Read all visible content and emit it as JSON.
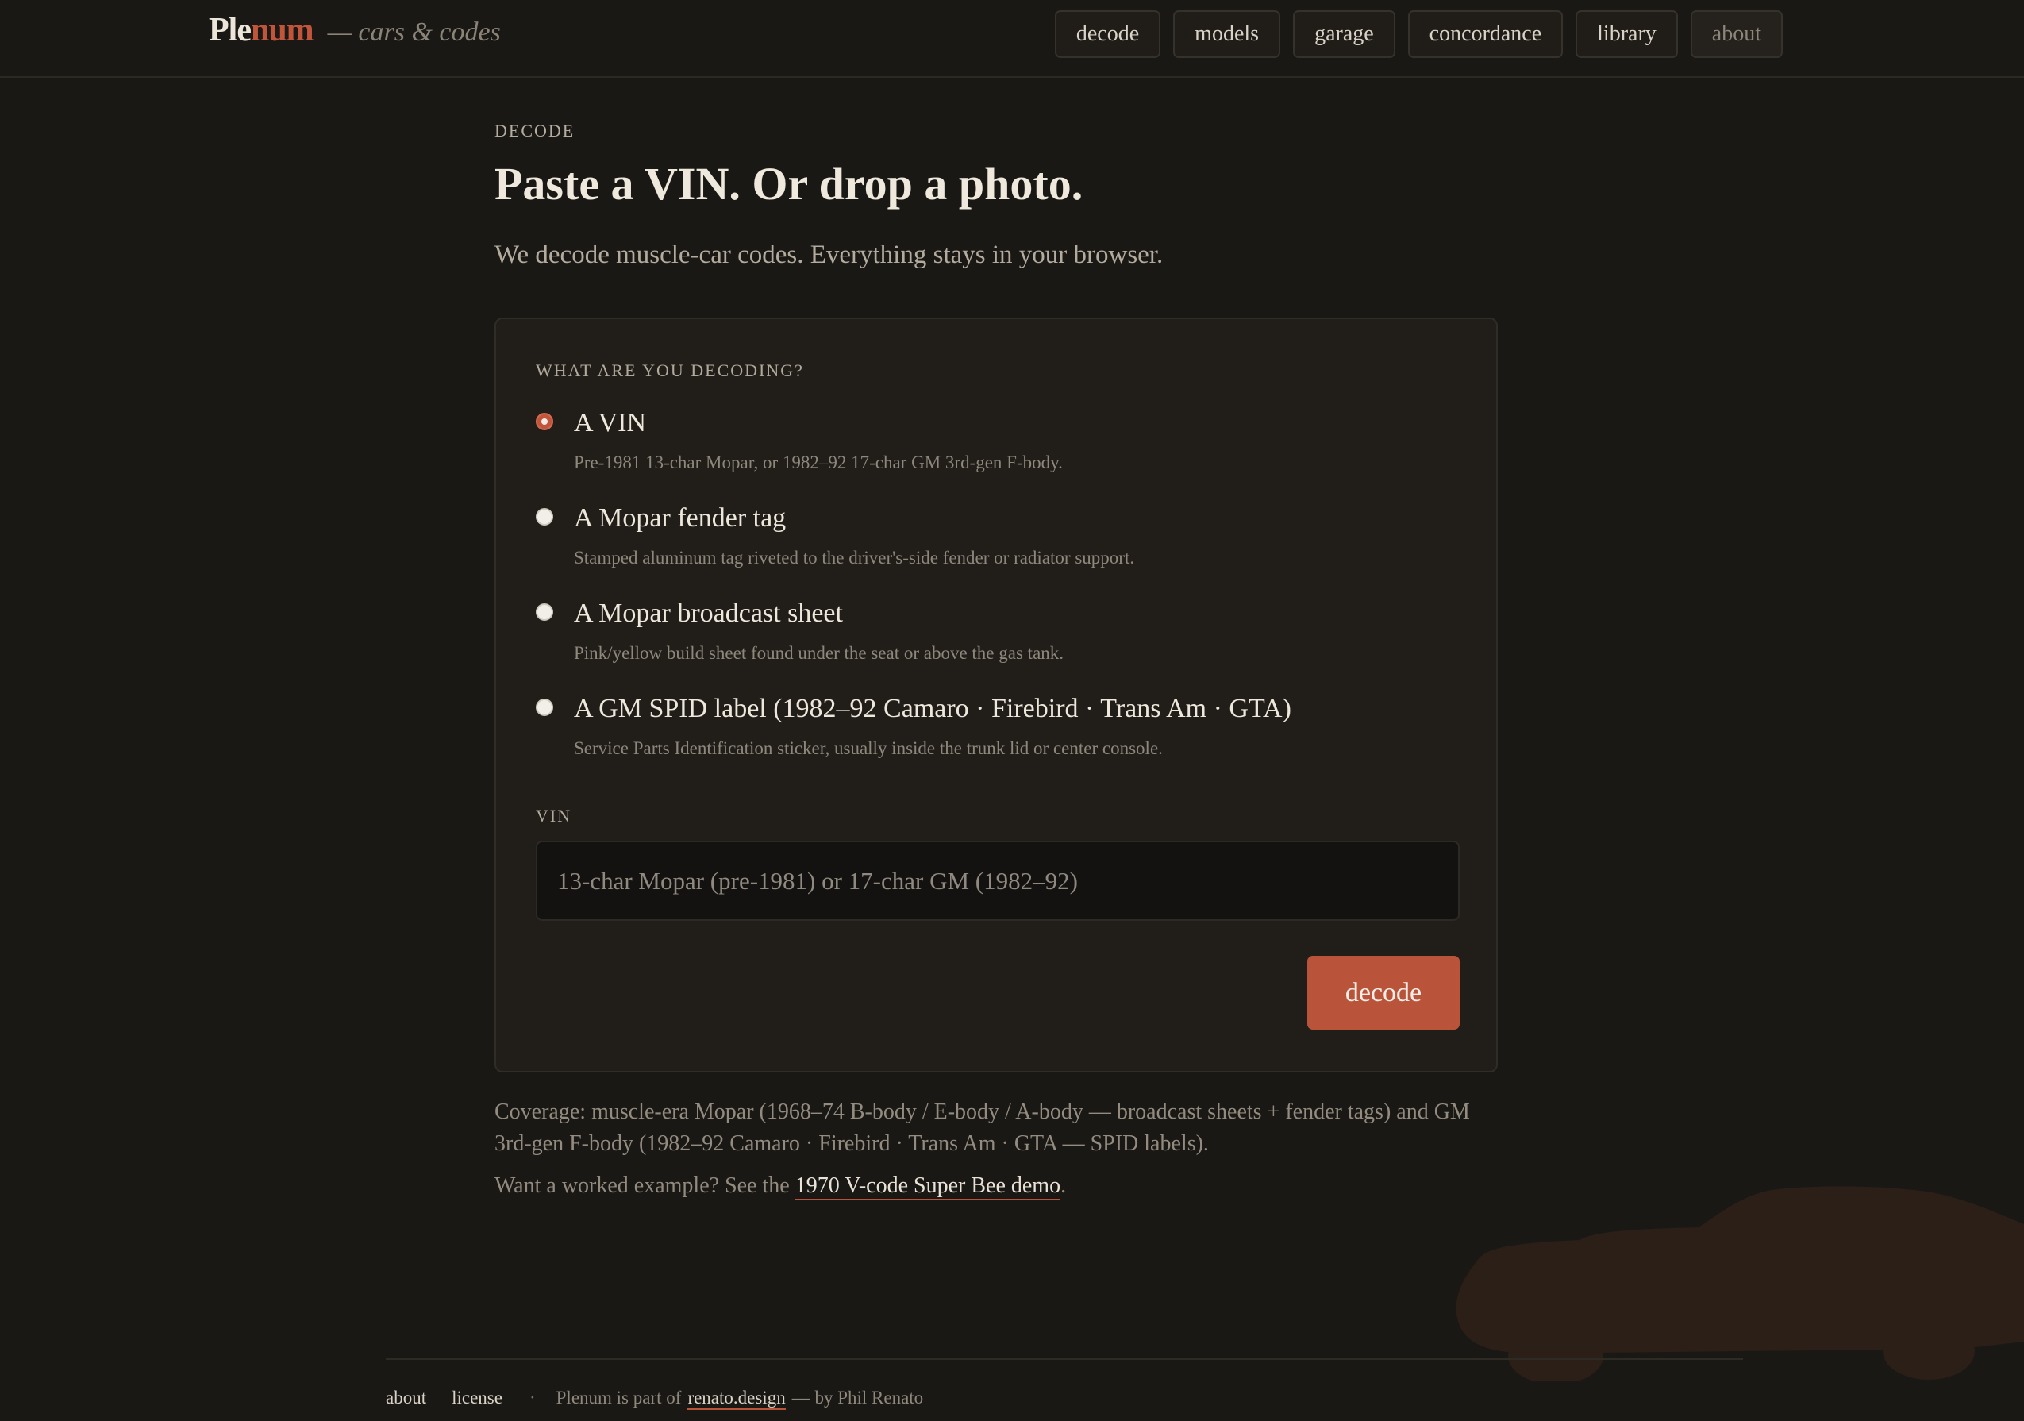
{
  "brand": {
    "name_a": "Ple",
    "name_b": "num",
    "tagline": "— cars & codes"
  },
  "nav": {
    "items": [
      {
        "label": "decode"
      },
      {
        "label": "models"
      },
      {
        "label": "garage"
      },
      {
        "label": "concordance"
      },
      {
        "label": "library"
      },
      {
        "label": "about"
      }
    ]
  },
  "main": {
    "eyebrow": "DECODE",
    "title": "Paste a VIN. Or drop a photo.",
    "lede": "We decode muscle-car codes. Everything stays in your browser."
  },
  "form": {
    "question": "WHAT ARE YOU DECODING?",
    "options": [
      {
        "title": "A VIN",
        "desc": "Pre-1981 13-char Mopar, or 1982–92 17-char GM 3rd-gen F-body.",
        "selected": true
      },
      {
        "title": "A Mopar fender tag",
        "desc": "Stamped aluminum tag riveted to the driver's-side fender or radiator support.",
        "selected": false
      },
      {
        "title": "A Mopar broadcast sheet",
        "desc": "Pink/yellow build sheet found under the seat or above the gas tank.",
        "selected": false
      },
      {
        "title": "A GM SPID label (1982–92 Camaro · Firebird · Trans Am · GTA)",
        "desc": "Service Parts Identification sticker, usually inside the trunk lid or center console.",
        "selected": false
      }
    ],
    "field_label": "VIN",
    "vin_placeholder": "13-char Mopar (pre-1981) or 17-char GM (1982–92)",
    "vin_value": "",
    "submit_label": "decode"
  },
  "notes": {
    "coverage": "Coverage: muscle-era Mopar (1968–74 B-body / E-body / A-body — broadcast sheets + fender tags) and GM 3rd-gen F-body (1982–92 Camaro · Firebird · Trans Am · GTA — SPID labels).",
    "example_prefix": "Want a worked example? See the ",
    "example_link": "1970 V-code Super Bee demo",
    "example_suffix": "."
  },
  "footer": {
    "about": "about",
    "license": "license",
    "separator": "·",
    "text_prefix": "Plenum is part of",
    "link": "renato.design",
    "text_suffix": "— by Phil Renato"
  },
  "colors": {
    "background": "#1a1814",
    "card": "#211e1a",
    "accent": "#b9533a",
    "brand_accent": "#c0553b"
  }
}
